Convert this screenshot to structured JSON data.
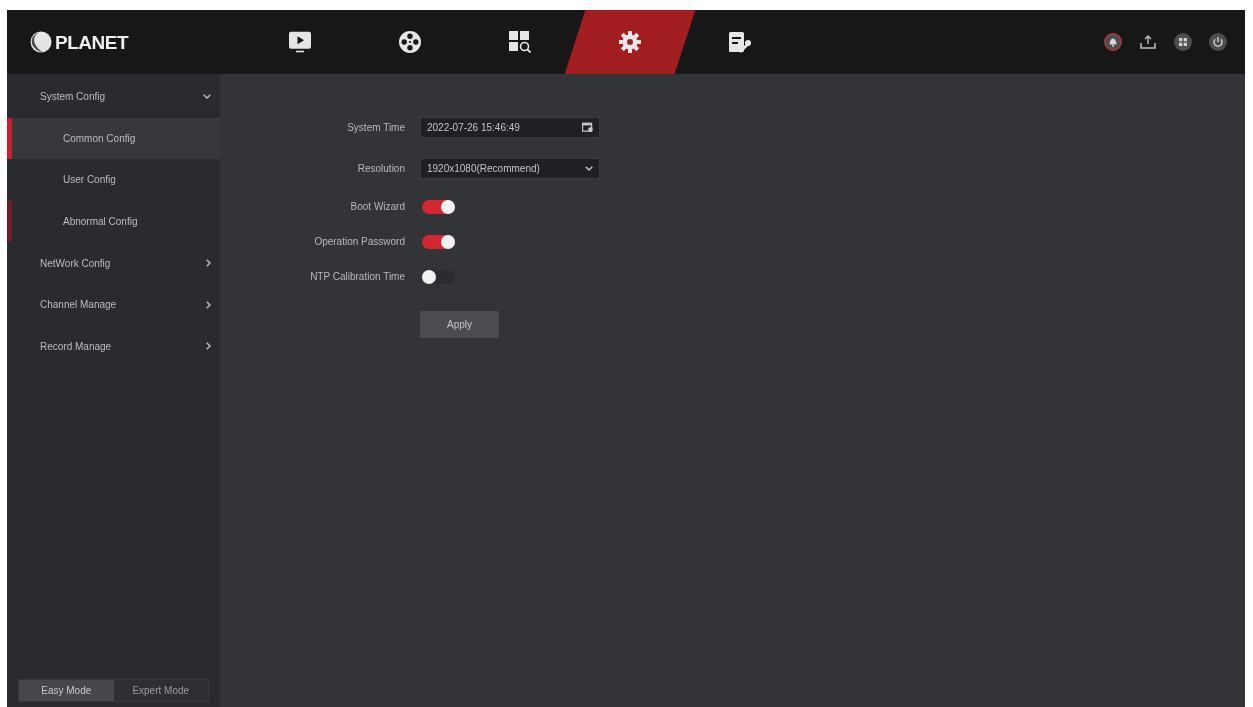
{
  "top_bar": {
    "logo": {
      "text": "PLANET"
    },
    "nav_tabs": [
      {
        "kind": "playback",
        "selected": false
      },
      {
        "kind": "reel",
        "selected": false
      },
      {
        "kind": "search",
        "selected": false
      },
      {
        "kind": "settings",
        "selected": true
      },
      {
        "kind": "log",
        "selected": false
      }
    ],
    "actions": [
      {
        "kind": "alarm"
      },
      {
        "kind": "tray"
      },
      {
        "kind": "grid"
      },
      {
        "kind": "power"
      }
    ]
  },
  "sidebar": {
    "items": [
      {
        "label": "System Config",
        "expanded": true,
        "children": [
          {
            "label": "Common Config",
            "selected": true,
            "hovered": false
          },
          {
            "label": "User Config",
            "selected": false,
            "hovered": false
          },
          {
            "label": "Abnormal Config",
            "selected": false,
            "hovered": true
          }
        ]
      },
      {
        "label": "NetWork Config",
        "expanded": false
      },
      {
        "label": "Channel Manage",
        "expanded": false
      },
      {
        "label": "Record Manage",
        "expanded": false
      }
    ],
    "modes": [
      {
        "label": "Easy Mode",
        "selected": true
      },
      {
        "label": "Expert Mode",
        "selected": false
      }
    ]
  },
  "form": {
    "fields": [
      {
        "kind": "datetime",
        "label": "System Time",
        "value": "2022-07-26 15:46:49"
      },
      {
        "kind": "select",
        "label": "Resolution",
        "value": "1920x1080(Recommend)"
      },
      {
        "kind": "toggle",
        "label": "Boot Wizard",
        "on": true
      },
      {
        "kind": "toggle",
        "label": "Operation Password",
        "on": true
      },
      {
        "kind": "toggle",
        "label": "NTP Calibration Time",
        "on": false
      }
    ],
    "apply_button": "Apply"
  }
}
